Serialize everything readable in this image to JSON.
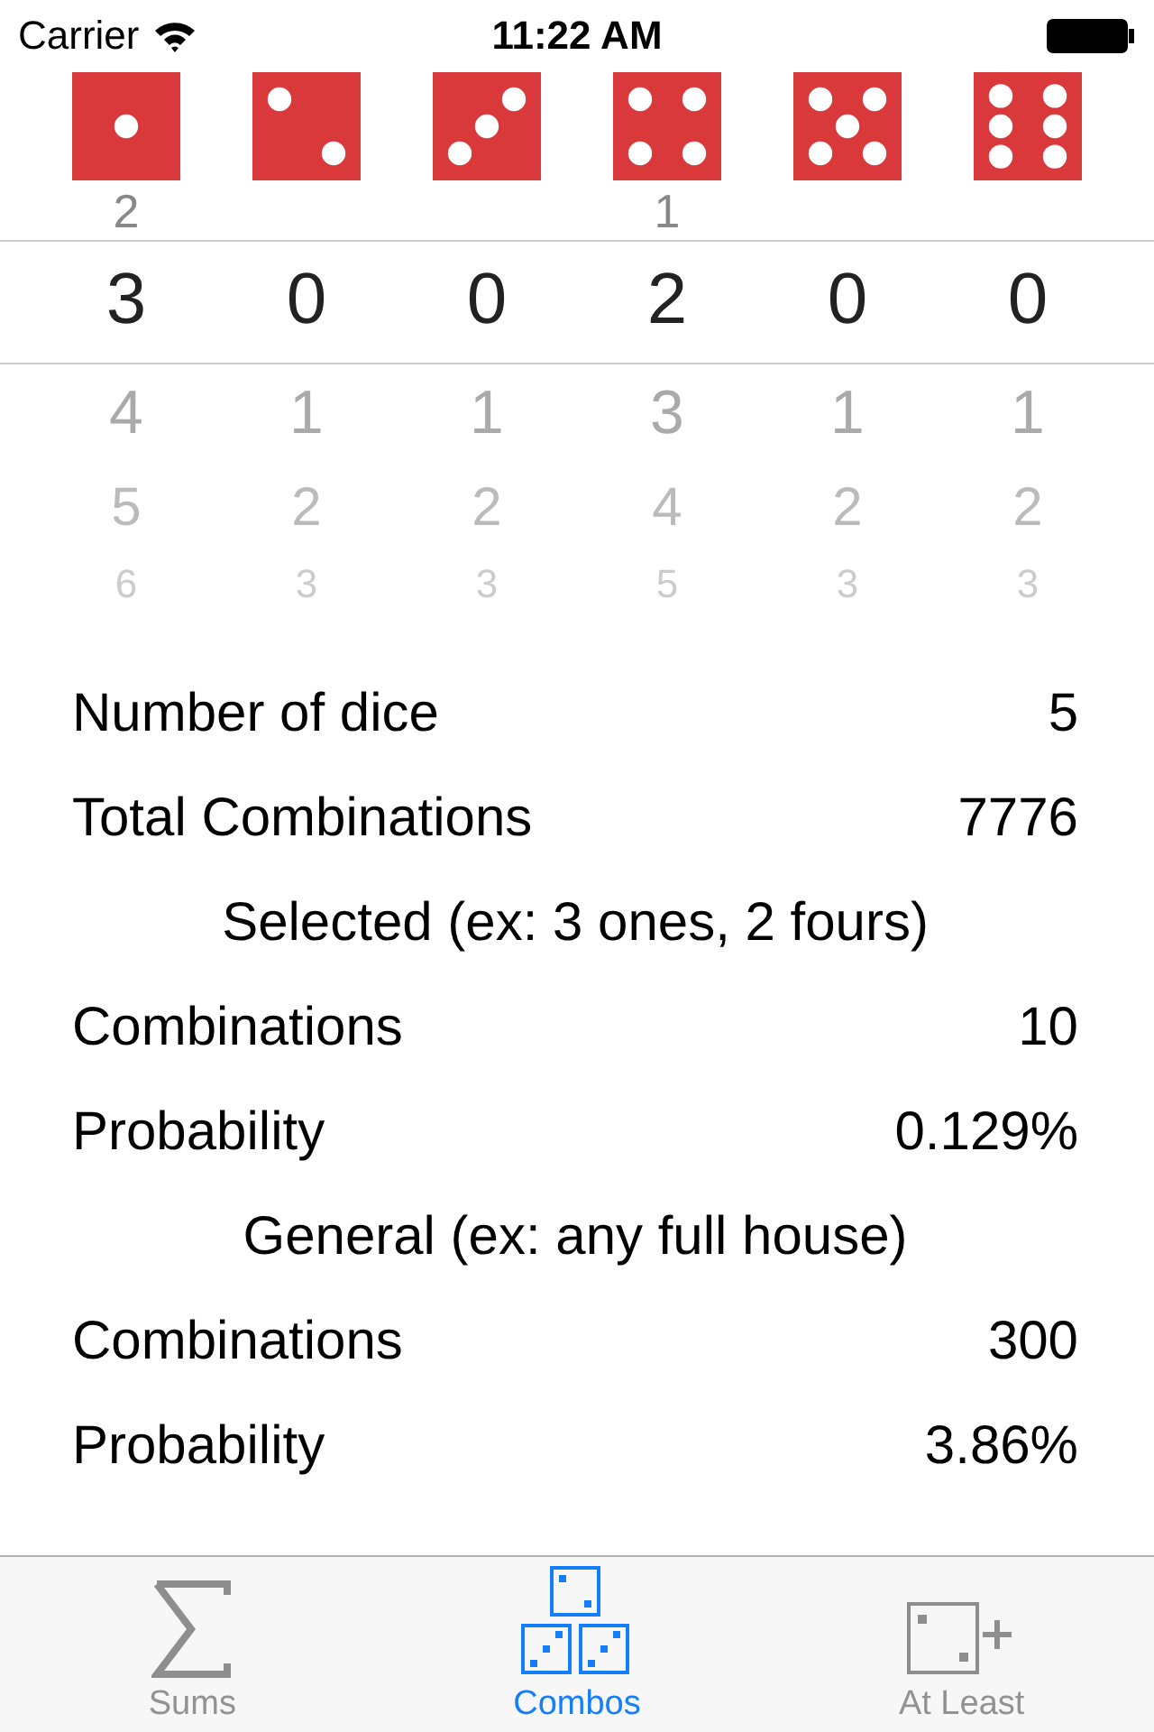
{
  "status_bar": {
    "carrier": "Carrier",
    "time": "11:22 AM"
  },
  "picker": {
    "columns": [
      {
        "above": [
          "2"
        ],
        "selected_value": "3",
        "below": [
          "4",
          "5",
          "6"
        ]
      },
      {
        "selected_value": "0",
        "below": [
          "1",
          "2",
          "3"
        ]
      },
      {
        "selected_value": "0",
        "below": [
          "1",
          "2",
          "3"
        ]
      },
      {
        "above": [
          "1"
        ],
        "selected_value": "2",
        "below": [
          "3",
          "4",
          "5"
        ]
      },
      {
        "selected_value": "0",
        "below": [
          "1",
          "2",
          "3"
        ]
      },
      {
        "selected_value": "0",
        "below": [
          "1",
          "2",
          "3"
        ]
      }
    ]
  },
  "stats": [
    {
      "kind": "row",
      "label": "Number of dice",
      "value": "5"
    },
    {
      "kind": "row",
      "label": "Total Combinations",
      "value": "7776"
    },
    {
      "kind": "heading",
      "label": "Selected (ex: 3 ones, 2 fours)"
    },
    {
      "kind": "row",
      "label": "Combinations",
      "value": "10"
    },
    {
      "kind": "row",
      "label": "Probability",
      "value": "0.129%"
    },
    {
      "kind": "heading",
      "label": "General (ex: any full house)"
    },
    {
      "kind": "row",
      "label": "Combinations",
      "value": "300"
    },
    {
      "kind": "row",
      "label": "Probability",
      "value": "3.86%"
    }
  ],
  "tab_bar": [
    {
      "label": "Sums",
      "selected": false
    },
    {
      "label": "Combos",
      "selected": true
    },
    {
      "label": "At Least",
      "selected": false
    }
  ]
}
